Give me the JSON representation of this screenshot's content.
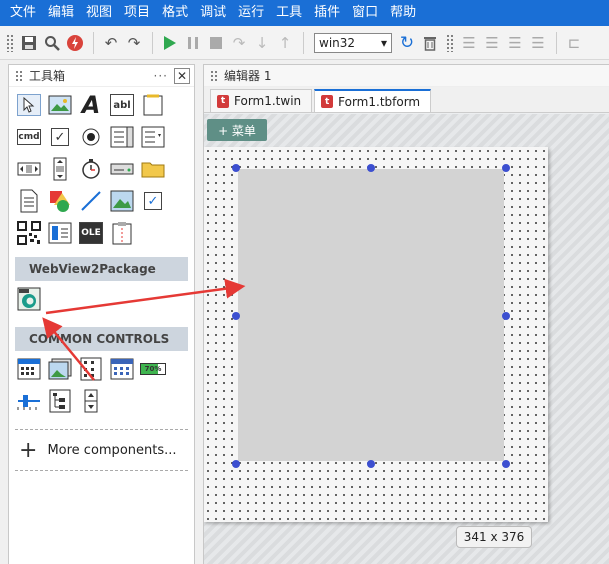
{
  "menu": [
    "文件",
    "编辑",
    "视图",
    "项目",
    "格式",
    "调试",
    "运行",
    "工具",
    "插件",
    "窗口",
    "帮助"
  ],
  "toolbar": {
    "platform_select": "win32"
  },
  "toolbox": {
    "title": "工具箱",
    "sections": {
      "webview": "WebView2Package",
      "common": "COMMON CONTROLS"
    },
    "tools": {
      "cmd": "cmd",
      "abl": "abl",
      "ole": "OLE",
      "pct": "70%"
    },
    "more_components": "More components..."
  },
  "editor": {
    "title": "编辑器 1",
    "tabs": [
      "Form1.twin",
      "Form1.tbform"
    ],
    "menu_button": "+ 菜单",
    "size_label": "341 x 376"
  },
  "colors": {
    "accent": "#1a6fd6",
    "arrow": "#e53935",
    "handle": "#3c4fd0"
  }
}
